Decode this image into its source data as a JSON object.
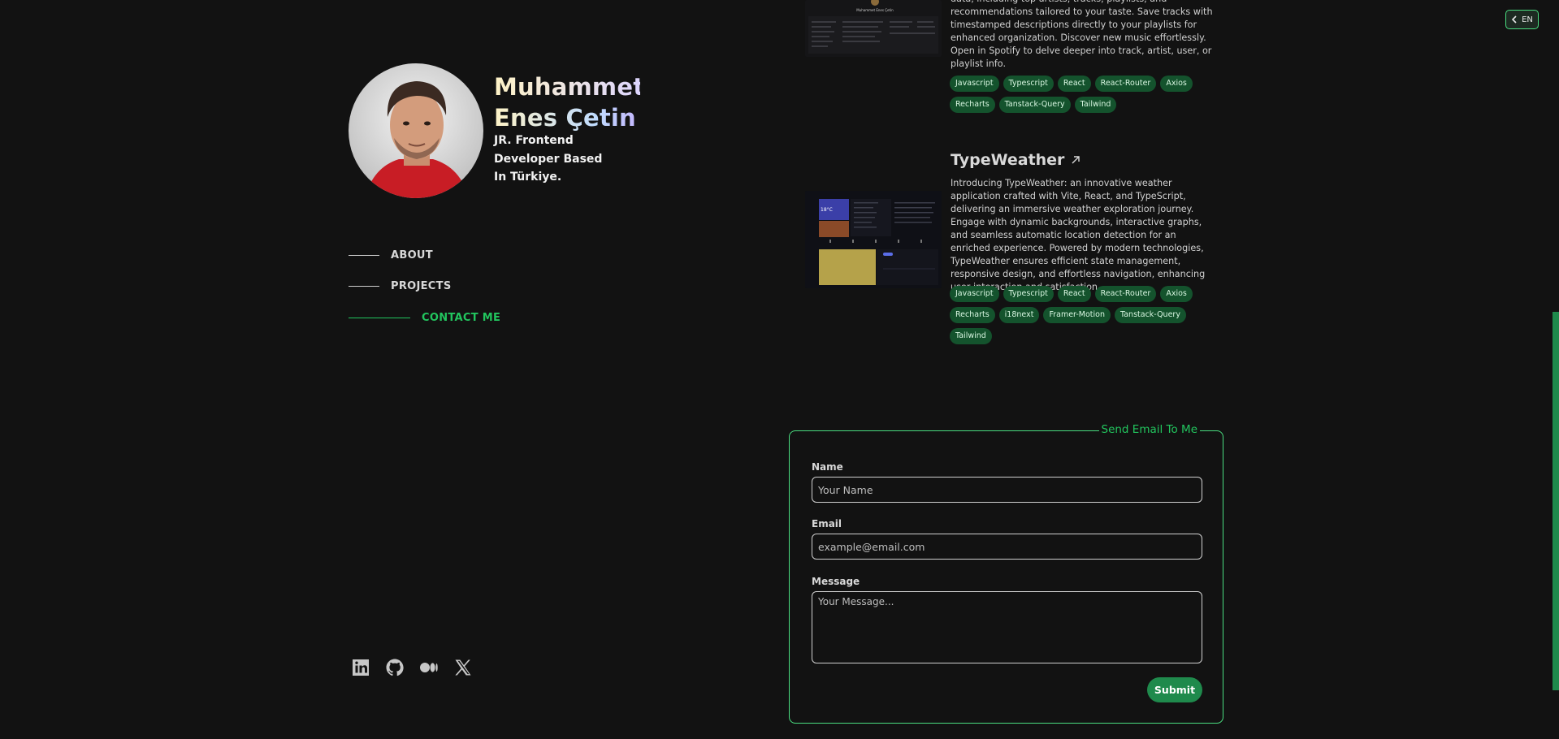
{
  "language": {
    "label": "EN",
    "icon": "chevron-left-icon"
  },
  "profile": {
    "name_line1": "Muhammet",
    "name_line2": "Enes Çetin",
    "subtitle": "JR. Frontend Developer Based In Türkiye."
  },
  "nav": {
    "items": [
      {
        "label": "ABOUT",
        "active": false
      },
      {
        "label": "PROJECTS",
        "active": false
      },
      {
        "label": "CONTACT ME",
        "active": true
      }
    ]
  },
  "socials": [
    "linkedin-icon",
    "github-icon",
    "medium-icon",
    "x-icon"
  ],
  "projects": [
    {
      "description_visible": "data, including top artists, tracks, playlists, and recommendations tailored to your taste. Save tracks with timestamped descriptions directly to your playlists for enhanced organization. Discover new music effortlessly. Open in Spotify to delve deeper into track, artist, user, or playlist info.",
      "screenshot_caption": "Muhammet Enes Çetin",
      "tags": [
        "Javascript",
        "Typescript",
        "React",
        "React-Router",
        "Axios",
        "Recharts",
        "Tanstack-Query",
        "Tailwind"
      ]
    },
    {
      "title": "TypeWeather",
      "description": "Introducing TypeWeather: an innovative weather application crafted with Vite, React, and TypeScript, delivering an immersive weather exploration journey. Engage with dynamic backgrounds, interactive graphs, and seamless automatic location detection for an enriched experience. Powered by modern technologies, TypeWeather ensures efficient state management, responsive design, and effortless navigation, enhancing user interaction and satisfaction.",
      "screenshot_temp": "18°C",
      "tags": [
        "Javascript",
        "Typescript",
        "React",
        "React-Router",
        "Axios",
        "Recharts",
        "i18next",
        "Framer-Motion",
        "Tanstack-Query",
        "Tailwind"
      ]
    }
  ],
  "contact_form": {
    "legend": "Send Email To Me",
    "name_label": "Name",
    "name_placeholder": "Your Name",
    "email_label": "Email",
    "email_placeholder": "example@email.com",
    "message_label": "Message",
    "message_placeholder": "Your Message...",
    "submit_label": "Submit"
  },
  "colors": {
    "background": "#121212",
    "accent": "#22c55e",
    "tag_bg": "#14532d"
  }
}
